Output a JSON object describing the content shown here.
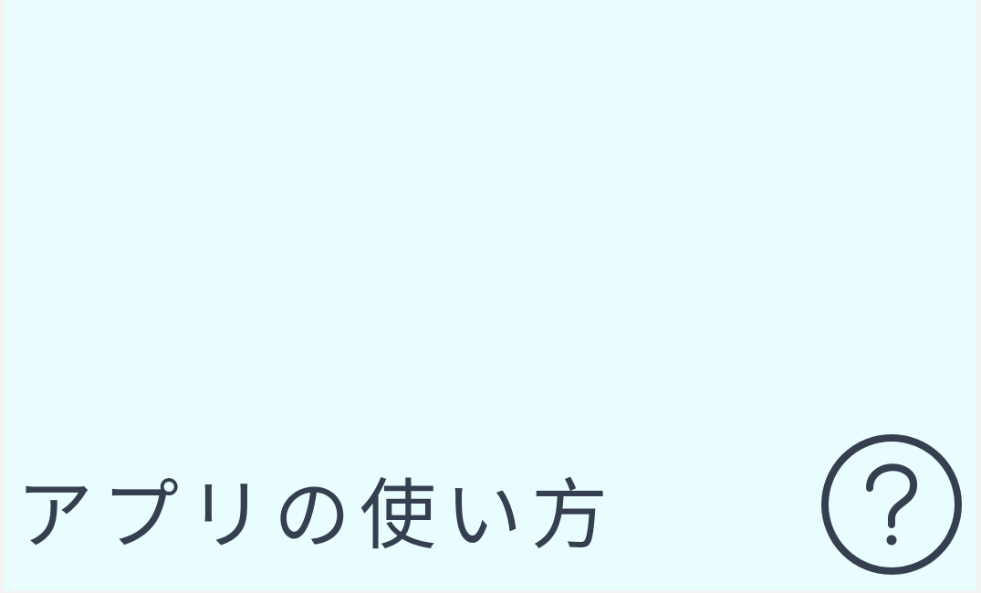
{
  "help_section": {
    "label": "アプリの使い方",
    "icon": "question-circle-icon",
    "colors": {
      "background": "#eafdfe",
      "text": "#363f50"
    }
  }
}
